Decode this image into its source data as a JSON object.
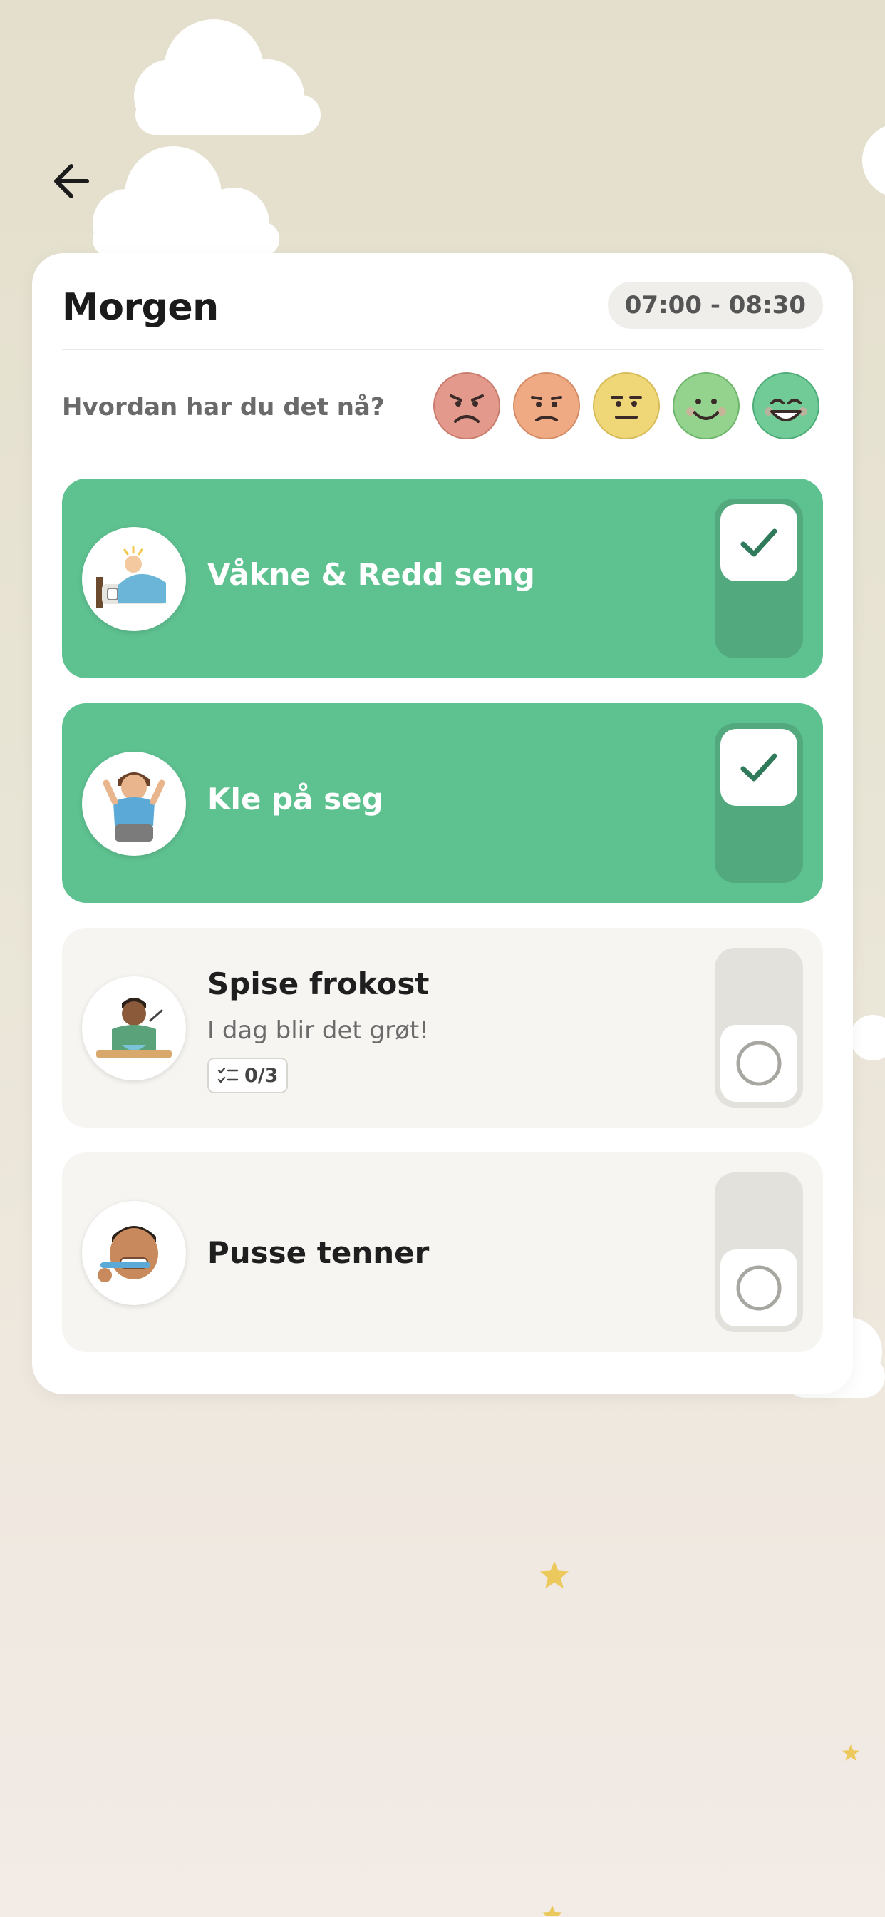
{
  "routine": {
    "title": "Morgen",
    "time_range": "07:00 - 08:30"
  },
  "mood": {
    "question": "Hvordan har du det nå?",
    "options": [
      {
        "name": "angry",
        "color": "#e39a8c",
        "border": "#c97c6e"
      },
      {
        "name": "annoyed",
        "color": "#efaa84",
        "border": "#d48c66"
      },
      {
        "name": "neutral",
        "color": "#efd677",
        "border": "#d6bc58"
      },
      {
        "name": "happy",
        "color": "#93d38e",
        "border": "#6fb56b"
      },
      {
        "name": "very-happy",
        "color": "#70cb96",
        "border": "#4eac78"
      }
    ]
  },
  "tasks": [
    {
      "title": "Våkne & Redd seng",
      "done": true
    },
    {
      "title": "Kle på seg",
      "done": true
    },
    {
      "title": "Spise frokost",
      "subtitle": "I dag blir det grøt!",
      "checklist": "0/3",
      "done": false
    },
    {
      "title": "Pusse tenner",
      "done": false
    }
  ],
  "colors": {
    "done_bg": "#5ec190",
    "todo_bg": "#f7f5f1",
    "check": "#2e7a5a",
    "star": "#ecc95c"
  }
}
